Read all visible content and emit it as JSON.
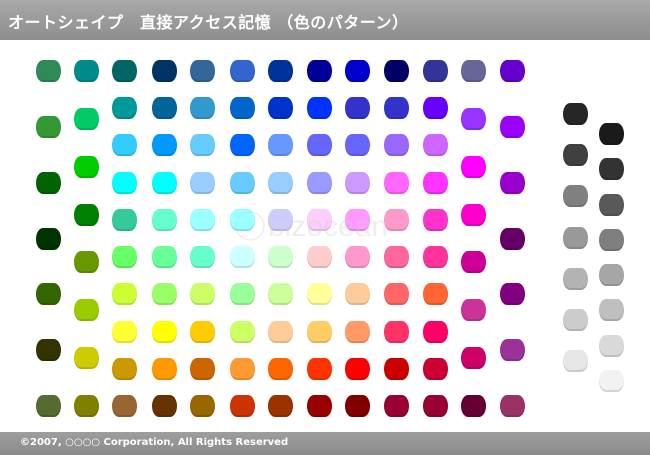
{
  "header": {
    "title": "オートシェイプ　直接アクセス記憶 （色のパターン）"
  },
  "footer": {
    "copyright": "©2007, ○○○○ Corporation, All Rights Reserved"
  },
  "palette": {
    "color_columns": [
      [
        "#2e8b57",
        "#339933",
        "#006400",
        "#003300",
        "#336600",
        "#333300",
        "#556b2f"
      ],
      [
        "#008b8b",
        "#00cc66",
        "#00cc00",
        "#008000",
        "#669900",
        "#99cc00",
        "#cccc00",
        "#808000"
      ],
      [
        "#006666",
        "#009999",
        "#33ccff",
        "#00ffff",
        "#33cc99",
        "#66ff66",
        "#ccff33",
        "#ffff33",
        "#cc9900",
        "#996633"
      ],
      [
        "#003366",
        "#006699",
        "#0099ff",
        "#00ffff",
        "#66ffcc",
        "#66ff99",
        "#99ff66",
        "#ffff00",
        "#ff9900",
        "#663300"
      ],
      [
        "#336699",
        "#3399cc",
        "#66ccff",
        "#99ccff",
        "#99ffff",
        "#66ffcc",
        "#ccff66",
        "#ffcc00",
        "#cc6600",
        "#996600"
      ],
      [
        "#3366cc",
        "#0066cc",
        "#0066ff",
        "#66ccff",
        "#99ffff",
        "#ccffff",
        "#99ff99",
        "#ccff66",
        "#ff9933",
        "#cc3300"
      ],
      [
        "#003399",
        "#0033cc",
        "#6699ff",
        "#99ccff",
        "#ccccff",
        "#ccffcc",
        "#ccff99",
        "#ffcc99",
        "#ff6600",
        "#993300"
      ],
      [
        "#000099",
        "#0033ff",
        "#6666ff",
        "#9999ff",
        "#ffccff",
        "#ffcccc",
        "#ffff99",
        "#ffcc66",
        "#ff3300",
        "#990000"
      ],
      [
        "#0000cc",
        "#3333cc",
        "#6666ff",
        "#cc99ff",
        "#ff99ff",
        "#ff99cc",
        "#ffcc99",
        "#ff9966",
        "#ff0000",
        "#800000"
      ],
      [
        "#000066",
        "#3333cc",
        "#9966ff",
        "#ff66ff",
        "#ff99cc",
        "#ff6699",
        "#ff6666",
        "#ff3366",
        "#cc0000",
        "#990033"
      ],
      [
        "#333399",
        "#6600ff",
        "#cc66ff",
        "#ff33ff",
        "#ff33cc",
        "#ff3399",
        "#ff6633",
        "#ff0066",
        "#cc0033",
        "#990033"
      ],
      [
        "#666699",
        "#9933ff",
        "#ff00ff",
        "#ff00cc",
        "#cc0099",
        "#cc3399",
        "#cc0066",
        "#660033"
      ],
      [
        "#6600cc",
        "#9900ff",
        "#9900cc",
        "#660066",
        "#800080",
        "#993399",
        "#993366"
      ]
    ],
    "gray_columns": [
      [
        "#262626",
        "#404040",
        "#808080",
        "#999999",
        "#b3b3b3",
        "#cccccc",
        "#e6e6e6"
      ],
      [
        "#1a1a1a",
        "#333333",
        "#595959",
        "#7f7f7f",
        "#a6a6a6",
        "#bfbfbf",
        "#d9d9d9",
        "#f2f2f2"
      ]
    ]
  },
  "watermark": {
    "text": "bizocean"
  }
}
